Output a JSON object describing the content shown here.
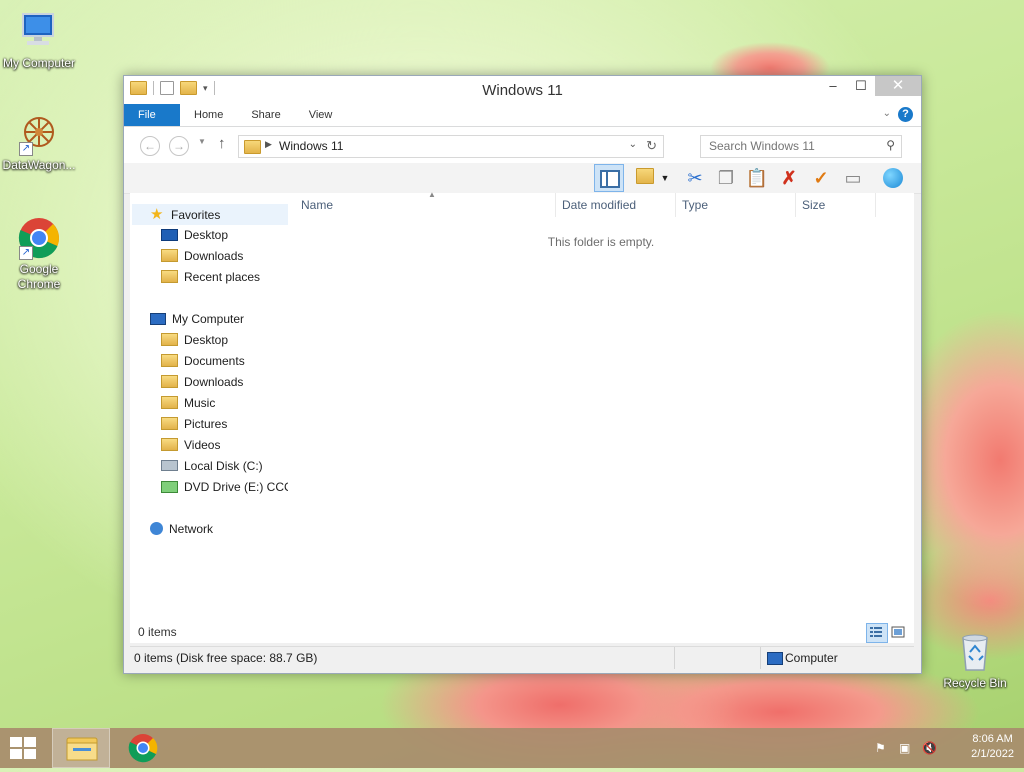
{
  "desktop": {
    "icons": [
      {
        "label": "My Computer",
        "icon": "computer-icon"
      },
      {
        "label": "DataWagon...",
        "icon": "datawagon-icon"
      },
      {
        "label": "Google Chrome",
        "icon": "chrome-icon"
      },
      {
        "label": "Recycle Bin",
        "icon": "recycle-bin-icon"
      }
    ]
  },
  "window": {
    "title": "Windows 11",
    "ribbon_tabs": [
      "File",
      "Home",
      "Share",
      "View"
    ],
    "address_path": "Windows 11",
    "search_placeholder": "Search Windows 11",
    "columns": [
      "Name",
      "Date modified",
      "Type",
      "Size"
    ],
    "empty_text": "This folder is empty.",
    "item_count": "0 items",
    "status_left": "0 items (Disk free space: 88.7 GB)",
    "status_right": "Computer"
  },
  "navpane": {
    "favorites": {
      "label": "Favorites",
      "items": [
        "Desktop",
        "Downloads",
        "Recent places"
      ]
    },
    "computer": {
      "label": "My Computer",
      "items": [
        "Desktop",
        "Documents",
        "Downloads",
        "Music",
        "Pictures",
        "Videos",
        "Local Disk (C:)",
        "DVD Drive (E:) CCCC"
      ]
    },
    "network": {
      "label": "Network"
    }
  },
  "taskbar": {
    "time": "8:06 AM",
    "date": "2/1/2022"
  },
  "colors": {
    "accent": "#1979ca",
    "taskbar": "#a88c6c"
  }
}
